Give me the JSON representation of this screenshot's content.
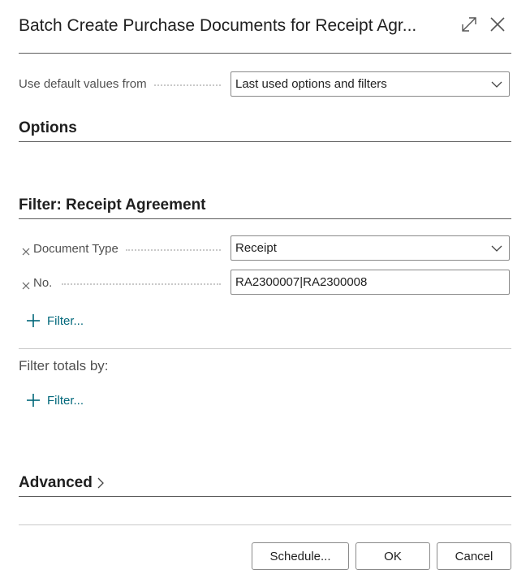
{
  "dialog": {
    "title": "Batch Create Purchase Documents for Receipt Agr..."
  },
  "defaults": {
    "label": "Use default values from",
    "value": "Last used options and filters"
  },
  "options": {
    "heading": "Options"
  },
  "filter": {
    "heading": "Filter: Receipt Agreement",
    "fields": [
      {
        "label": "Document Type",
        "value": "Receipt"
      },
      {
        "label": "No.",
        "value": "RA2300007|RA2300008"
      }
    ],
    "add_label": "Filter..."
  },
  "totals": {
    "heading": "Filter totals by:",
    "add_label": "Filter..."
  },
  "advanced": {
    "heading": "Advanced"
  },
  "buttons": {
    "schedule": "Schedule...",
    "ok": "OK",
    "cancel": "Cancel"
  },
  "icons": {
    "expand": "expand-icon",
    "close": "close-icon",
    "chevron": "chevron-down-icon",
    "remove": "remove-filter-icon",
    "add": "plus-icon",
    "advanced_chevron": "chevron-right-icon"
  },
  "colors": {
    "accent": "#00677a",
    "border": "#8a8a8a",
    "text": "#212121"
  }
}
